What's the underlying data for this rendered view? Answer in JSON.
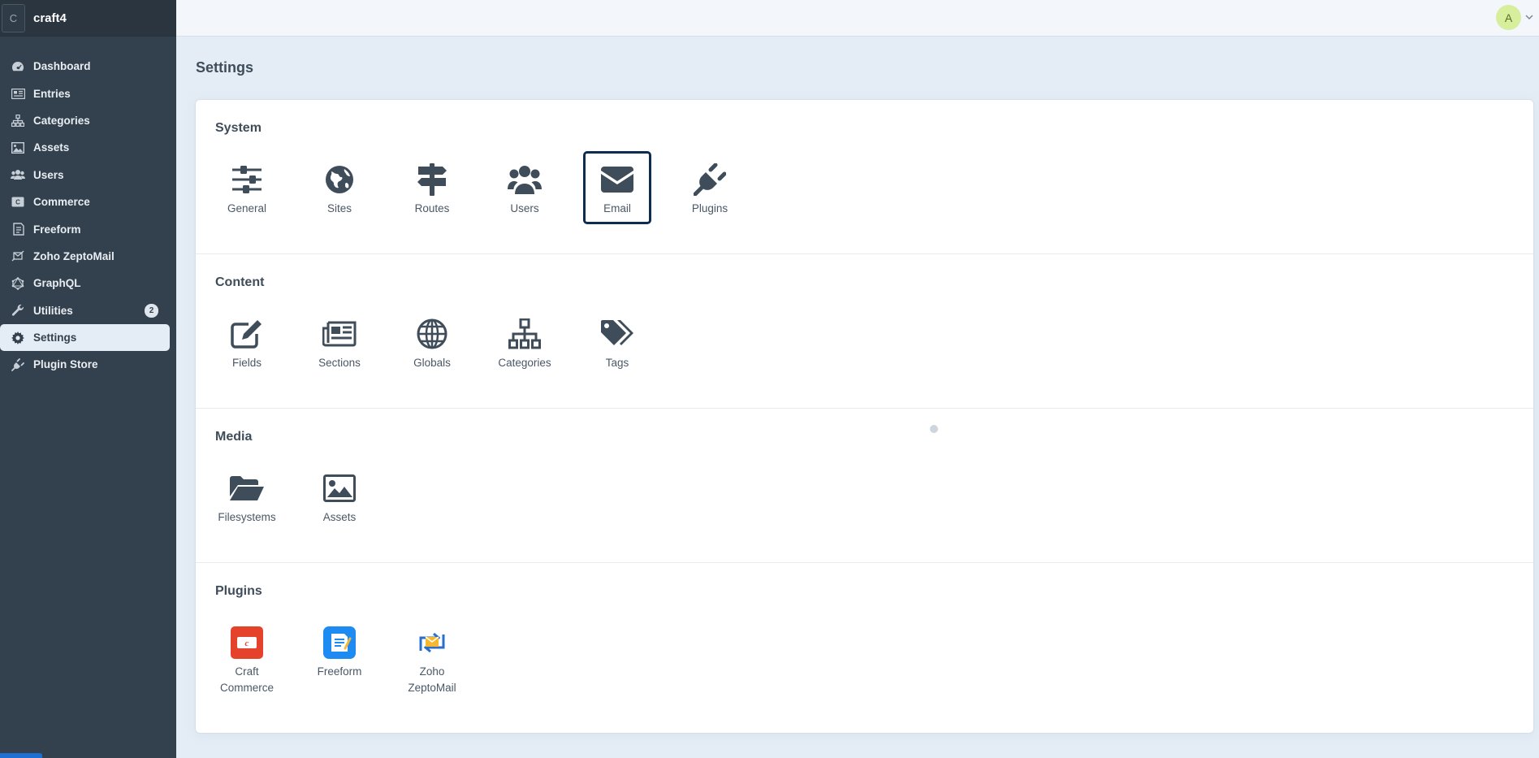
{
  "site": {
    "logo_letter": "C",
    "name": "craft4"
  },
  "nav": [
    {
      "label": "Dashboard",
      "icon": "gauge-icon"
    },
    {
      "label": "Entries",
      "icon": "newspaper-icon"
    },
    {
      "label": "Categories",
      "icon": "sitemap-icon"
    },
    {
      "label": "Assets",
      "icon": "image-icon"
    },
    {
      "label": "Users",
      "icon": "users-icon"
    },
    {
      "label": "Commerce",
      "icon": "commerce-icon"
    },
    {
      "label": "Freeform",
      "icon": "freeform-icon"
    },
    {
      "label": "Zoho ZeptoMail",
      "icon": "zeptomail-icon"
    },
    {
      "label": "GraphQL",
      "icon": "graphql-icon"
    },
    {
      "label": "Utilities",
      "icon": "wrench-icon",
      "badge": "2"
    },
    {
      "label": "Settings",
      "icon": "gear-icon",
      "active": true
    },
    {
      "label": "Plugin Store",
      "icon": "plug-icon"
    }
  ],
  "user": {
    "avatar_letter": "A"
  },
  "page": {
    "title": "Settings"
  },
  "sections": [
    {
      "title": "System",
      "tiles": [
        {
          "label": "General",
          "icon": "sliders-icon"
        },
        {
          "label": "Sites",
          "icon": "globe-americas-icon"
        },
        {
          "label": "Routes",
          "icon": "signpost-icon"
        },
        {
          "label": "Users",
          "icon": "users-icon"
        },
        {
          "label": "Email",
          "icon": "envelope-icon",
          "focused": true
        },
        {
          "label": "Plugins",
          "icon": "plug-icon"
        }
      ]
    },
    {
      "title": "Content",
      "tiles": [
        {
          "label": "Fields",
          "icon": "edit-icon"
        },
        {
          "label": "Sections",
          "icon": "newspaper-icon"
        },
        {
          "label": "Globals",
          "icon": "globe-grid-icon"
        },
        {
          "label": "Categories",
          "icon": "sitemap-icon"
        },
        {
          "label": "Tags",
          "icon": "tags-icon"
        }
      ]
    },
    {
      "title": "Media",
      "tiles": [
        {
          "label": "Filesystems",
          "icon": "folder-open-icon"
        },
        {
          "label": "Assets",
          "icon": "image-icon"
        }
      ]
    },
    {
      "title": "Plugins",
      "tiles": [
        {
          "label": "Craft Commerce",
          "icon": "craft-commerce-icon"
        },
        {
          "label": "Freeform",
          "icon": "freeform-icon"
        },
        {
          "label": "Zoho ZeptoMail",
          "icon": "zeptomail-icon"
        }
      ]
    }
  ],
  "colors": {
    "sidebar": "#33404d",
    "accent": "#0d2c4f",
    "icon": "#3f4d5a",
    "background": "#e4edf6"
  }
}
